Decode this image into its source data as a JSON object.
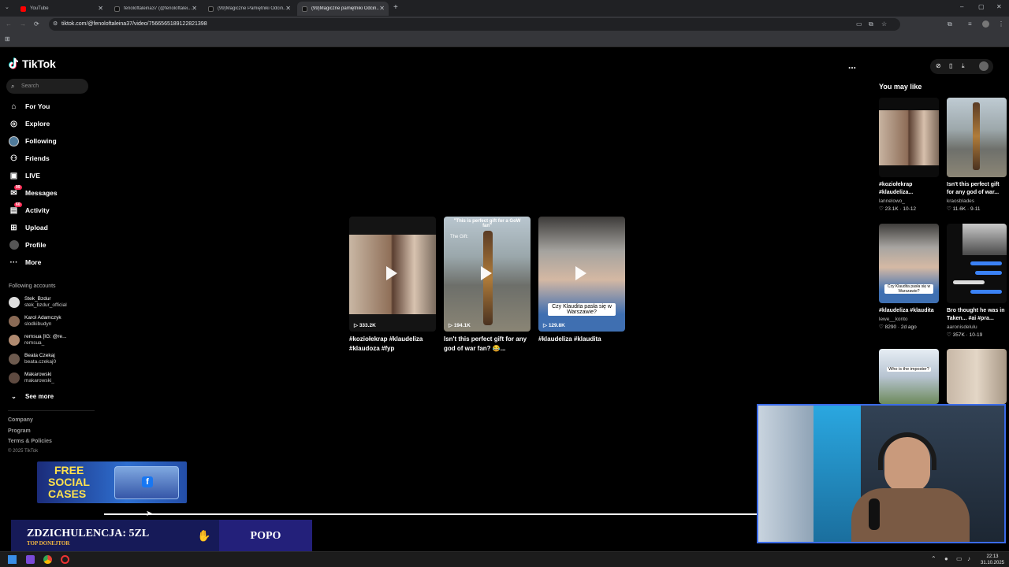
{
  "browser": {
    "tabs": [
      {
        "title": "YouTube",
        "active": false
      },
      {
        "title": "fenoloftaleina37 (@fenoloftalei...",
        "active": false
      },
      {
        "title": "(99)Magiczne Pamiętniki Odcin...",
        "active": false
      },
      {
        "title": "(99)Magiczne pamiętniki Odcin...",
        "active": true
      }
    ],
    "url": "tiktok.com/@fenoloftaleina37/video/7566565189122821398"
  },
  "tiktok": {
    "logo": "TikTok",
    "search_placeholder": "Search",
    "nav": [
      {
        "label": "For You",
        "icon": "home-icon"
      },
      {
        "label": "Explore",
        "icon": "compass-icon"
      },
      {
        "label": "Following",
        "icon": "following-icon"
      },
      {
        "label": "Friends",
        "icon": "friends-icon"
      },
      {
        "label": "LIVE",
        "icon": "live-icon"
      },
      {
        "label": "Messages",
        "icon": "messages-icon",
        "badge": "99"
      },
      {
        "label": "Activity",
        "icon": "activity-icon",
        "badge": "60"
      },
      {
        "label": "Upload",
        "icon": "upload-icon"
      },
      {
        "label": "Profile",
        "icon": "profile-icon"
      },
      {
        "label": "More",
        "icon": "more-icon"
      }
    ],
    "following_title": "Following accounts",
    "following": [
      {
        "name": "Stek_Bzdur",
        "user": "stek_bzdur_official"
      },
      {
        "name": "Karol Adamczyk",
        "user": "slodkibudyn"
      },
      {
        "name": "remsua [IG: @re...",
        "user": "remsua_"
      },
      {
        "name": "Beata Czekaj",
        "user": "beata.czekaj0"
      },
      {
        "name": "Makarowski",
        "user": "makarowski_"
      }
    ],
    "see_more": "See more",
    "footer": [
      "Company",
      "Program",
      "Terms & Policies",
      "© 2025 TikTok"
    ],
    "more_menu": "...",
    "grid": [
      {
        "views": "333.2K",
        "caption": "#koziołekrap #klaudeliza #klaudoza #fyp"
      },
      {
        "views": "194.1K",
        "caption": "Isn't this perfect gift for any god of war fan? 😂...",
        "overlay_top": "\"This is perfect gift for a GoW fan\"",
        "overlay_mid": "The Gift:"
      },
      {
        "views": "129.8K",
        "caption": "#klaudeliza #klaudita",
        "overlay_mid": "Czy Klaudita pasła się w Warszawie?"
      }
    ],
    "you_may_like": "You may like",
    "suggested": [
      {
        "caption": "#koziołekrap #klaudeliza...",
        "author": "lannelowo_",
        "likes": "23.1K",
        "date": "10-12"
      },
      {
        "caption": "Isn't this perfect gift for any god of war...",
        "author": "kraosblades",
        "likes": "11.6K",
        "date": "9-11"
      },
      {
        "caption": "#klaudeliza #klaudita",
        "author": "lewe__konto",
        "likes": "8290",
        "date": "2d ago",
        "overlay": "Czy Klaudita pasła się w Warszawie?"
      },
      {
        "caption": "Bro thought he was in Taken... #ai #pra...",
        "author": "aaronisdelulu",
        "likes": "357K",
        "date": "10-19"
      },
      {
        "overlay": "Who is the imposter?"
      },
      {}
    ]
  },
  "stream": {
    "promo": {
      "line1": "FREE",
      "line2": "SOCIAL",
      "line3": "CASES"
    },
    "donor": {
      "title": "ZDZICHULENCJA: 5ZL",
      "subtitle": "TOP DONEJTOR",
      "name": "POPO"
    }
  },
  "taskbar": {
    "time": "22:13",
    "date": "31.10.2025"
  }
}
